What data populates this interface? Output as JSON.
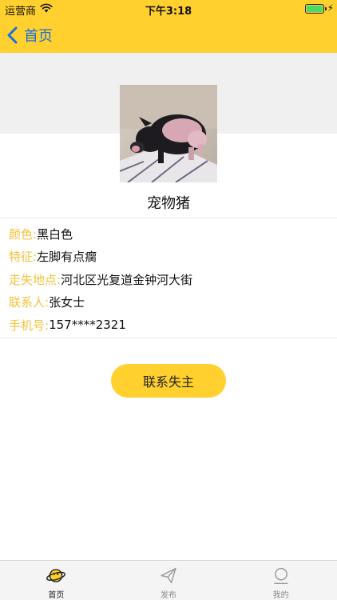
{
  "status_bar": {
    "carrier": "运营商",
    "time": "下午3:18",
    "battery_level": 1.0
  },
  "nav": {
    "back_label": "首页"
  },
  "pet": {
    "name": "宠物猪",
    "photo_icon": "pig-photo"
  },
  "info": [
    {
      "label": "颜色:",
      "value": "黑白色"
    },
    {
      "label": "特征:",
      "value": "左脚有点瘸"
    },
    {
      "label": "走失地点:",
      "value": "河北区光复道金钟河大街"
    },
    {
      "label": "联系人:",
      "value": "张女士"
    },
    {
      "label": "手机号:",
      "value": "157****2321"
    }
  ],
  "actions": {
    "contact_label": "联系失主"
  },
  "tabbar": {
    "tabs": [
      {
        "label": "首页",
        "icon": "planet-icon",
        "active": true
      },
      {
        "label": "发布",
        "icon": "send-icon",
        "active": false
      },
      {
        "label": "我的",
        "icon": "profile-icon",
        "active": false
      }
    ]
  },
  "colors": {
    "accent": "#FFD02E",
    "label": "#F2C23A",
    "link": "#1a6fe0"
  }
}
